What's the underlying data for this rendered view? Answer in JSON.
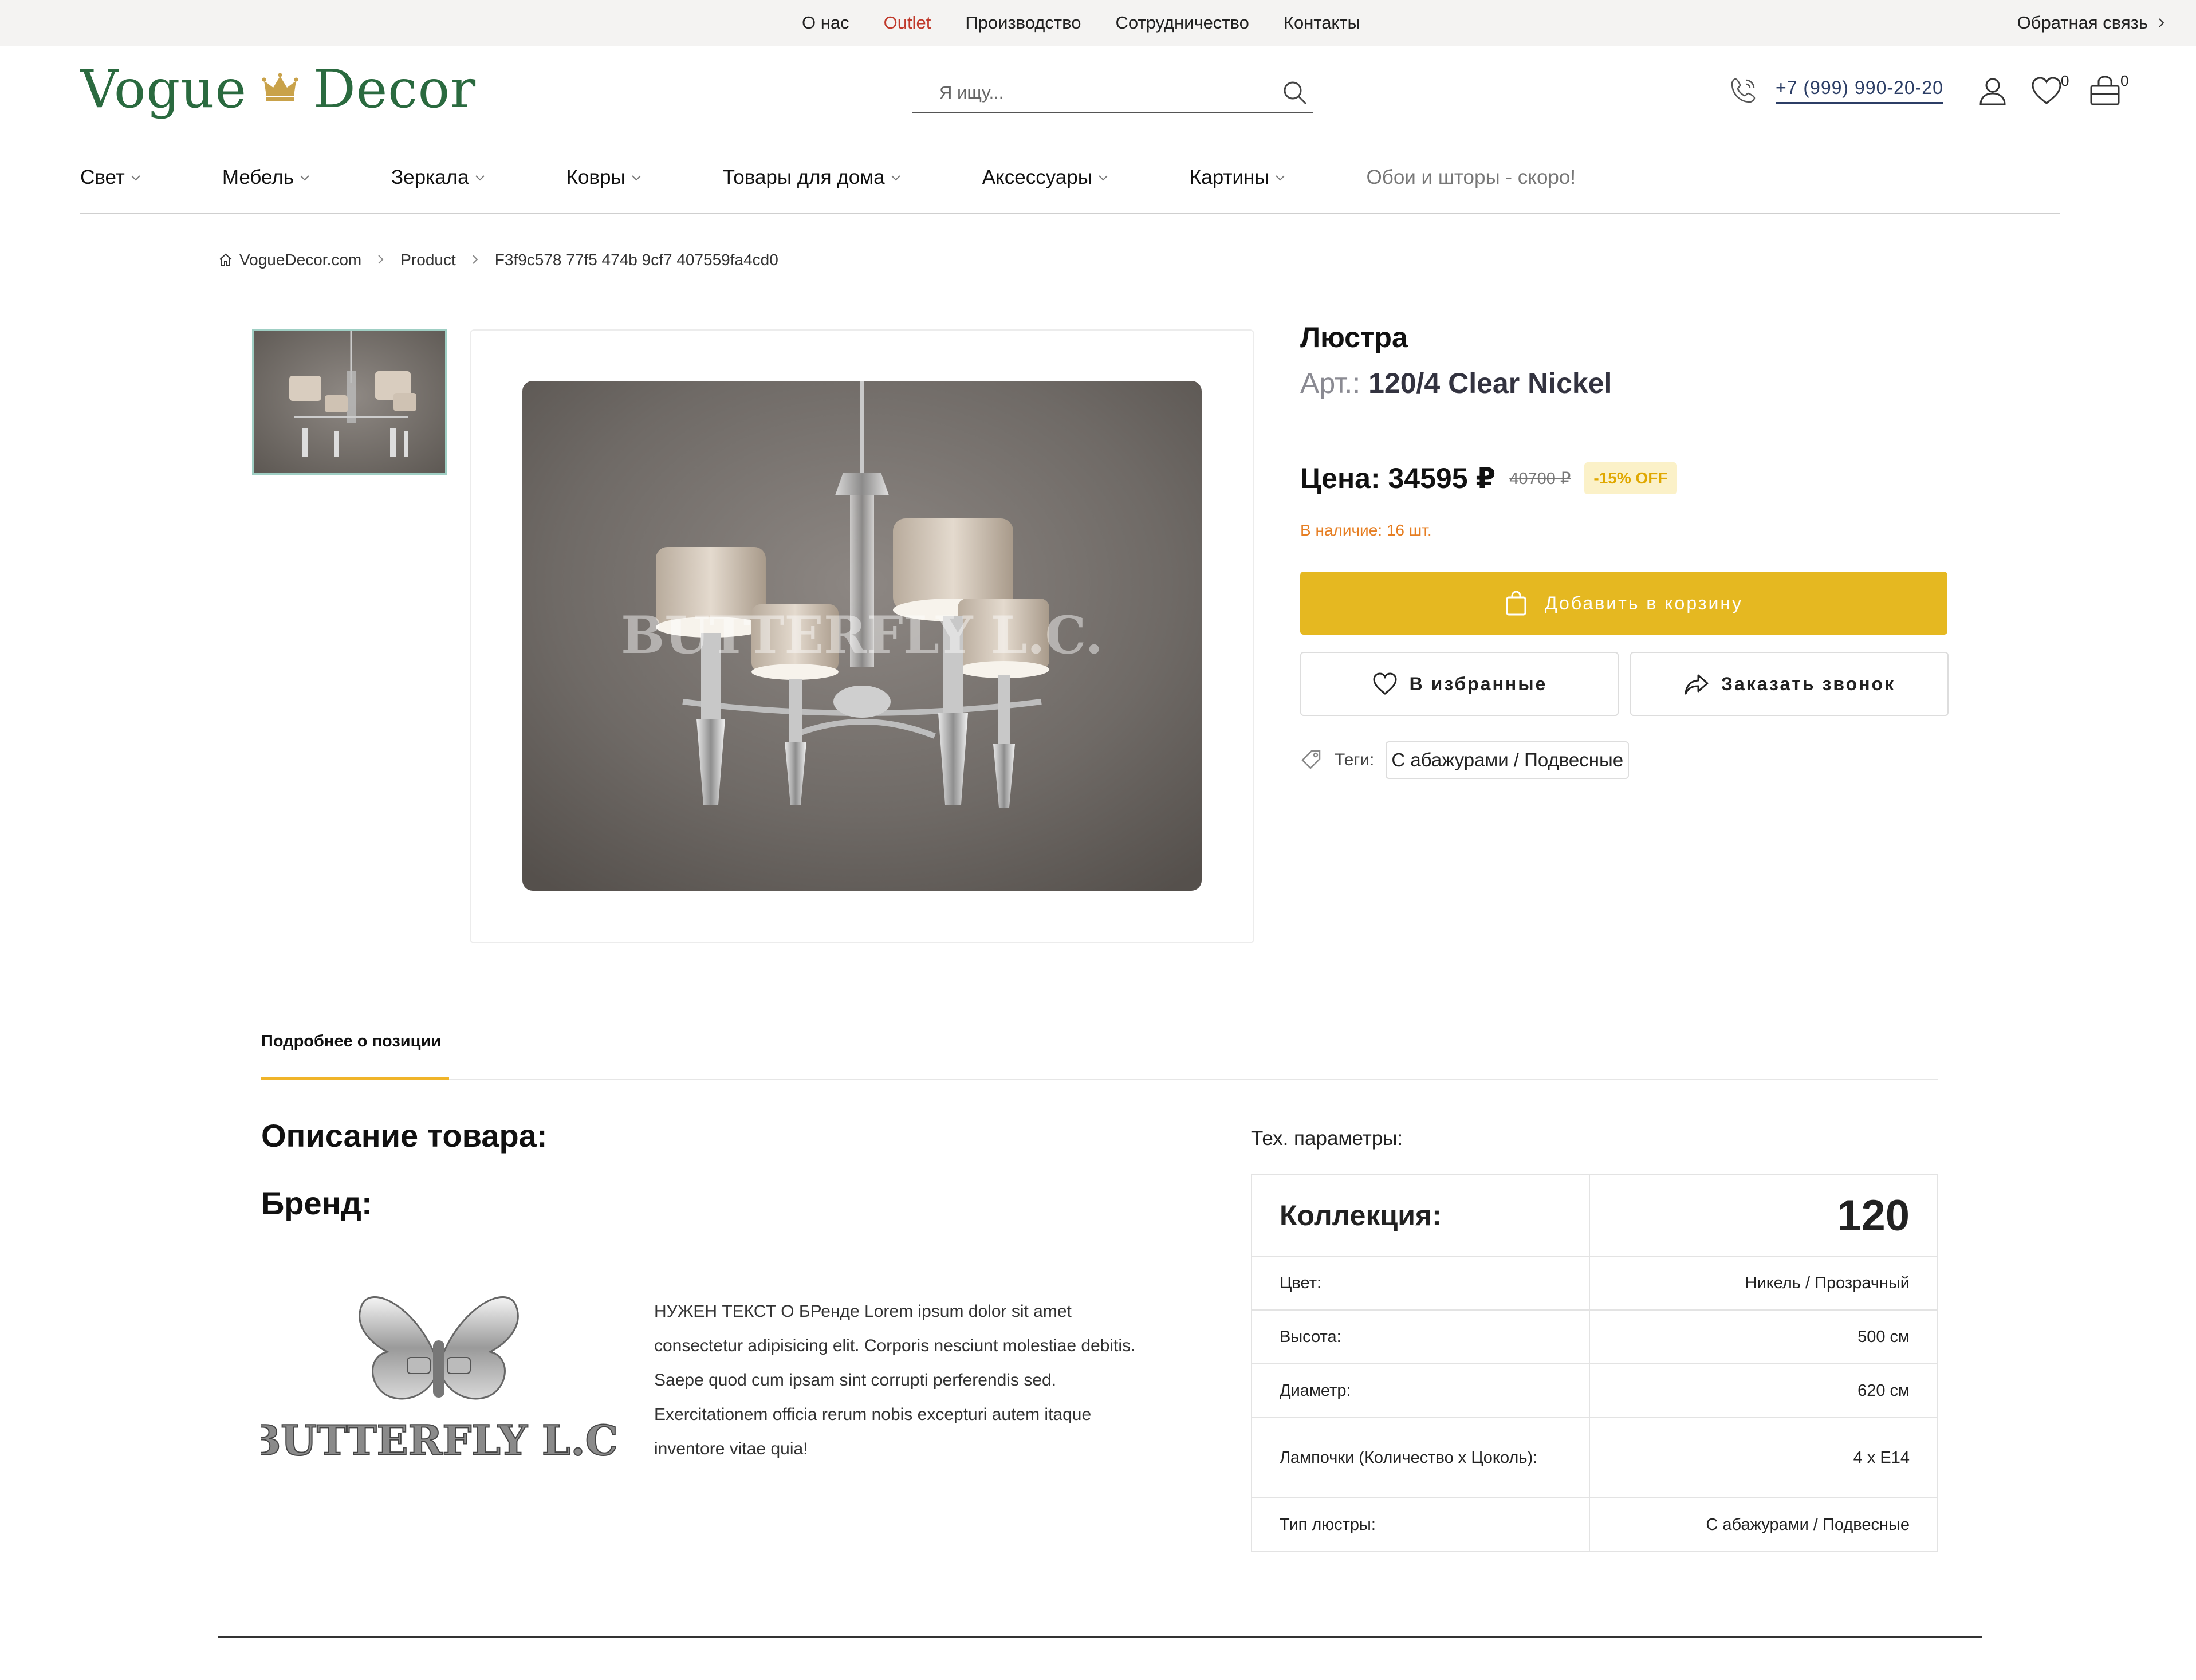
{
  "topbar": {
    "links": [
      "О нас",
      "Outlet",
      "Производство",
      "Сотрудничество",
      "Контакты"
    ],
    "feedback": "Обратная связь"
  },
  "header": {
    "logo_left": "Vogue",
    "logo_right": "Decor",
    "search_placeholder": "Я ищу...",
    "phone": "+7 (999) 990-20-20",
    "wishlist_count": "0",
    "cart_count": "0"
  },
  "nav": {
    "items": [
      "Свет",
      "Мебель",
      "Зеркала",
      "Ковры",
      "Товары для дома",
      "Аксессуары",
      "Картины"
    ],
    "soon": "Обои и шторы - скоро!"
  },
  "breadcrumb": [
    "VogueDecor.com",
    "Product",
    "F3f9c578 77f5 474b 9cf7 407559fa4cd0"
  ],
  "product": {
    "name": "Люстра",
    "article_label": "Арт.:",
    "article": "120/4 Clear Nickel",
    "price": "Цена: 34595 ₽",
    "old_price": "40700 ₽",
    "discount": "-15% OFF",
    "stock": "В наличие: 16 шт.",
    "add_to_cart": "Добавить в корзину",
    "favorite": "В избранные",
    "callback": "Заказать звонок",
    "tags_label": "Теги:",
    "tag": "С абажурами / Подвесные",
    "watermark": "BUTTERFLY L.C."
  },
  "tabs": [
    "Подробнее о позиции"
  ],
  "description": {
    "title": "Описание товара:",
    "brand_title": "Бренд:",
    "brand_logo_text": "BUTTERFLY L.C.",
    "text": "НУЖЕН ТЕКСТ О БРенде Lorem ipsum dolor sit amet consectetur adipisicing elit. Corporis nesciunt molestiae debitis. Saepe quod cum ipsam sint corrupti perferendis sed. Exercitationem officia rerum nobis excepturi autem itaque inventore vitae quia!"
  },
  "specs": {
    "title": "Тех. параметры:",
    "rows": [
      {
        "k": "Коллекция:",
        "v": "120"
      },
      {
        "k": "Цвет:",
        "v": "Никель / Прозрачный"
      },
      {
        "k": "Высота:",
        "v": "500 см"
      },
      {
        "k": "Диаметр:",
        "v": "620 см"
      },
      {
        "k": "Лампочки (Количество x Цоколь):",
        "v": "4 x E14"
      },
      {
        "k": "Тип люстры:",
        "v": "С абажурами / Подвесные"
      }
    ]
  },
  "colors": {
    "accent": "#e5b821",
    "logo_green": "#2a6a3f",
    "outlet_red": "#c0392b",
    "stock_orange": "#e67e22"
  }
}
